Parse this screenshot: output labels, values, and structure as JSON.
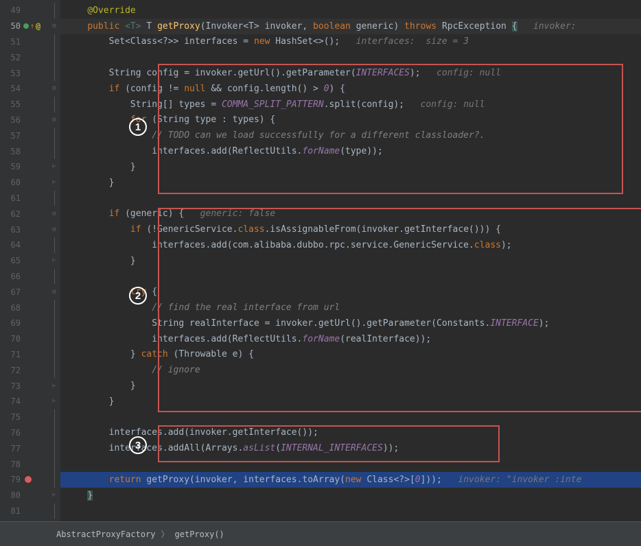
{
  "lines": {
    "start": 49,
    "end": 81,
    "current": 50,
    "breakpoint": 79
  },
  "annotations": {
    "circle1": "1",
    "circle2": "2",
    "circle3": "3"
  },
  "code": {
    "l49_anno": "@Override",
    "l50_public": "public",
    "l50_generic": " <T> ",
    "l50_ret": "T ",
    "l50_method": "getProxy",
    "l50_sig1": "(Invoker<T> invoker, ",
    "l50_bool": "boolean",
    "l50_sig2": " generic) ",
    "l50_throws": "throws",
    "l50_exc": " RpcException ",
    "l50_brace": "{",
    "l50_hint": "   invoker:",
    "l51_set": "Set<Class<?>> interfaces = ",
    "l51_new": "new",
    "l51_hash": " HashSet<>();",
    "l51_hint": "   interfaces:  size = 3",
    "l53_a": "String config = invoker.getUrl().getParameter(",
    "l53_const": "INTERFACES",
    "l53_b": ");",
    "l53_hint": "   config: null",
    "l54_if": "if",
    "l54_a": " (config != ",
    "l54_null": "null",
    "l54_b": " && config.length() > ",
    "l54_zero": "0",
    "l54_c": ") {",
    "l55_a": "String[] types = ",
    "l55_const": "COMMA_SPLIT_PATTERN",
    "l55_b": ".split(config);",
    "l55_hint": "   config: null",
    "l56_for": "for",
    "l56_a": " (String type : types) {",
    "l57_comment": "// TODO can we load successfully for a different classloader?.",
    "l58_a": "interfaces.add(ReflectUtils.",
    "l58_method": "forName",
    "l58_b": "(type));",
    "l59_brace": "}",
    "l60_brace": "}",
    "l62_if": "if",
    "l62_a": " (generic) {",
    "l62_hint": "   generic: false",
    "l63_if": "if",
    "l63_a": " (!GenericService.",
    "l63_class": "class",
    "l63_b": ".isAssignableFrom(invoker.getInterface())) {",
    "l64_a": "interfaces.add(com.alibaba.dubbo.rpc.service.GenericService.",
    "l64_class": "class",
    "l64_b": ");",
    "l65_brace": "}",
    "l67_try": "try",
    "l67_a": " {",
    "l68_comment": "// find the real interface from url",
    "l69_a": "String realInterface = invoker.getUrl().getParameter(Constants.",
    "l69_const": "INTERFACE",
    "l69_b": ");",
    "l70_a": "interfaces.add(ReflectUtils.",
    "l70_method": "forName",
    "l70_b": "(realInterface));",
    "l71_a": "} ",
    "l71_catch": "catch",
    "l71_b": " (Throwable e) {",
    "l72_comment": "// ignore",
    "l73_brace": "}",
    "l74_brace": "}",
    "l76_a": "interfaces.add(invoker.getInterface());",
    "l77_a": "interfaces.addAll(Arrays.",
    "l77_method": "asList",
    "l77_b": "(",
    "l77_const": "INTERNAL_INTERFACES",
    "l77_c": "));",
    "l79_return": "return",
    "l79_a": " getProxy(invoker, interfaces.toArray(",
    "l79_new": "new",
    "l79_b": " Class<?>[",
    "l79_zero": "0",
    "l79_c": "]));",
    "l79_hint": "   invoker: \"invoker :inte",
    "l80_brace": "}"
  },
  "breadcrumb": {
    "item1": "AbstractProxyFactory",
    "item2": "getProxy()",
    "sep": "〉"
  }
}
